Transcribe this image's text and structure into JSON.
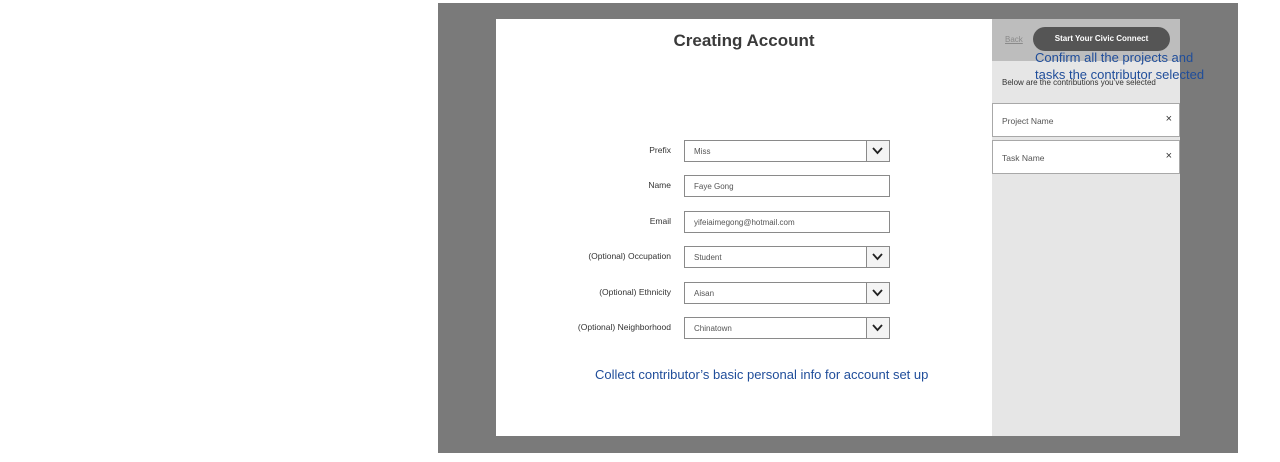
{
  "form": {
    "title": "Creating Account",
    "fields": [
      {
        "label": "Prefix",
        "value": "Miss",
        "dropdown": true
      },
      {
        "label": "Name",
        "value": "Faye Gong",
        "dropdown": false
      },
      {
        "label": "Email",
        "value": "yifeiaimegong@hotmail.com",
        "dropdown": false
      },
      {
        "label": "(Optional) Occupation",
        "value": "Student",
        "dropdown": true
      },
      {
        "label": "(Optional) Ethnicity",
        "value": "Aisan",
        "dropdown": true
      },
      {
        "label": "(Optional) Neighborhood",
        "value": "Chinatown",
        "dropdown": true
      }
    ],
    "annotation": "Collect contributor’s basic personal info for account set up"
  },
  "sidebar": {
    "back_label": "Back",
    "start_button": "Start Your Civic Connect",
    "annotation_line1": "Confirm all the projects and",
    "annotation_line2": "tasks the contributor selected",
    "subtitle": "Below are the contributions you’ve selected",
    "items": [
      {
        "label": "Project Name",
        "remove": "×"
      },
      {
        "label": "Task Name",
        "remove": "×"
      }
    ]
  },
  "colors": {
    "annotation": "#1f4d9a",
    "backdrop": "#7a7a7a",
    "button": "#555555"
  },
  "icons": {
    "dropdown": "chevron-down-icon",
    "remove": "close-icon"
  }
}
